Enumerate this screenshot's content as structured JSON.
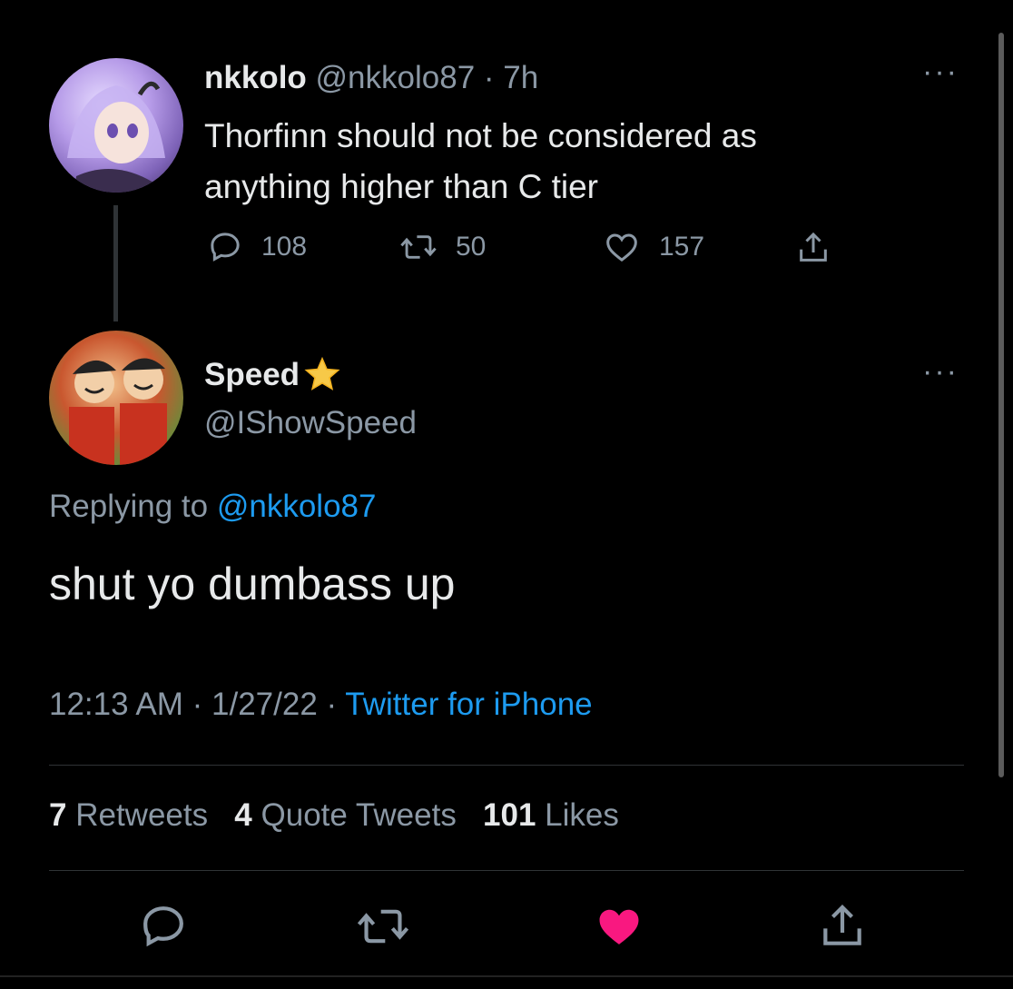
{
  "parent_tweet": {
    "display_name": "nkkolo",
    "handle": "@nkkolo87",
    "time": "7h",
    "text_line1": "Thorfinn should not be considered as",
    "text_line2": "anything higher than C tier",
    "replies": "108",
    "retweets": "50",
    "likes": "157",
    "more_label": "···"
  },
  "reply_tweet": {
    "display_name": "Speed",
    "handle": "@IShowSpeed",
    "replying_prefix": "Replying to",
    "replying_handle": "@nkkolo87",
    "text": "shut yo dumbass up",
    "time": "12:13 AM",
    "date": "1/27/22",
    "source": "Twitter for iPhone",
    "separator": "·",
    "more_label": "···",
    "stats": {
      "retweets_count": "7",
      "retweets_label": "Retweets",
      "quotes_count": "4",
      "quotes_label": "Quote Tweets",
      "likes_count": "101",
      "likes_label": "Likes"
    }
  },
  "icons": {
    "reply": "speech-bubble-icon",
    "retweet": "retweet-icon",
    "like": "heart-icon",
    "share": "share-icon",
    "badge": "star-icon"
  },
  "colors": {
    "background": "#000000",
    "text": "#e7e9ea",
    "muted": "#8b98a5",
    "link": "#1d9bf0",
    "liked": "#f91880",
    "star": "#f7c948"
  }
}
